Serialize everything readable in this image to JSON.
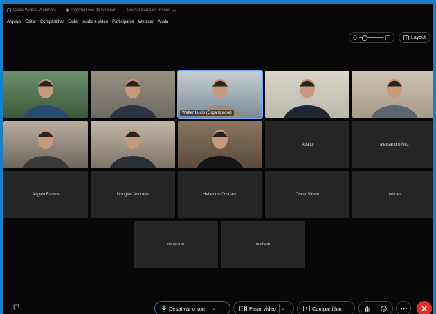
{
  "app": {
    "title": "Cisco Webex Webinars",
    "info": "Informações do webinar",
    "hide_menu": "Ocultar barra de menus"
  },
  "menu": [
    "Arquivo",
    "Editar",
    "Compartilhar",
    "Exibir",
    "Áudio e vídeo",
    "Participante",
    "Webinar",
    "Ajuda"
  ],
  "toolbar": {
    "layout_label": "Layout"
  },
  "participants": [
    {
      "name": ""
    },
    {
      "name": ""
    },
    {
      "name": "Walter Lucio (Organizador)",
      "active": true
    },
    {
      "name": ""
    },
    {
      "name": ""
    },
    {
      "name": ""
    },
    {
      "name": ""
    },
    {
      "name": ""
    },
    {
      "name": "Adalto"
    },
    {
      "name": "alexsandro filez"
    },
    {
      "name": "Angelo Ramos"
    },
    {
      "name": "Douglas Andrade"
    },
    {
      "name": "Heberton Cristiano"
    },
    {
      "name": "Oscar Vasco"
    },
    {
      "name": "pericles"
    },
    {
      "name": "roberson"
    },
    {
      "name": "walison"
    }
  ],
  "controls": {
    "mute_label": "Desativar o som",
    "video_label": "Parar vídeo",
    "share_label": "Compartilhar"
  },
  "colors": {
    "end_call": "#e0302a",
    "active_border": "#66a8ff"
  }
}
